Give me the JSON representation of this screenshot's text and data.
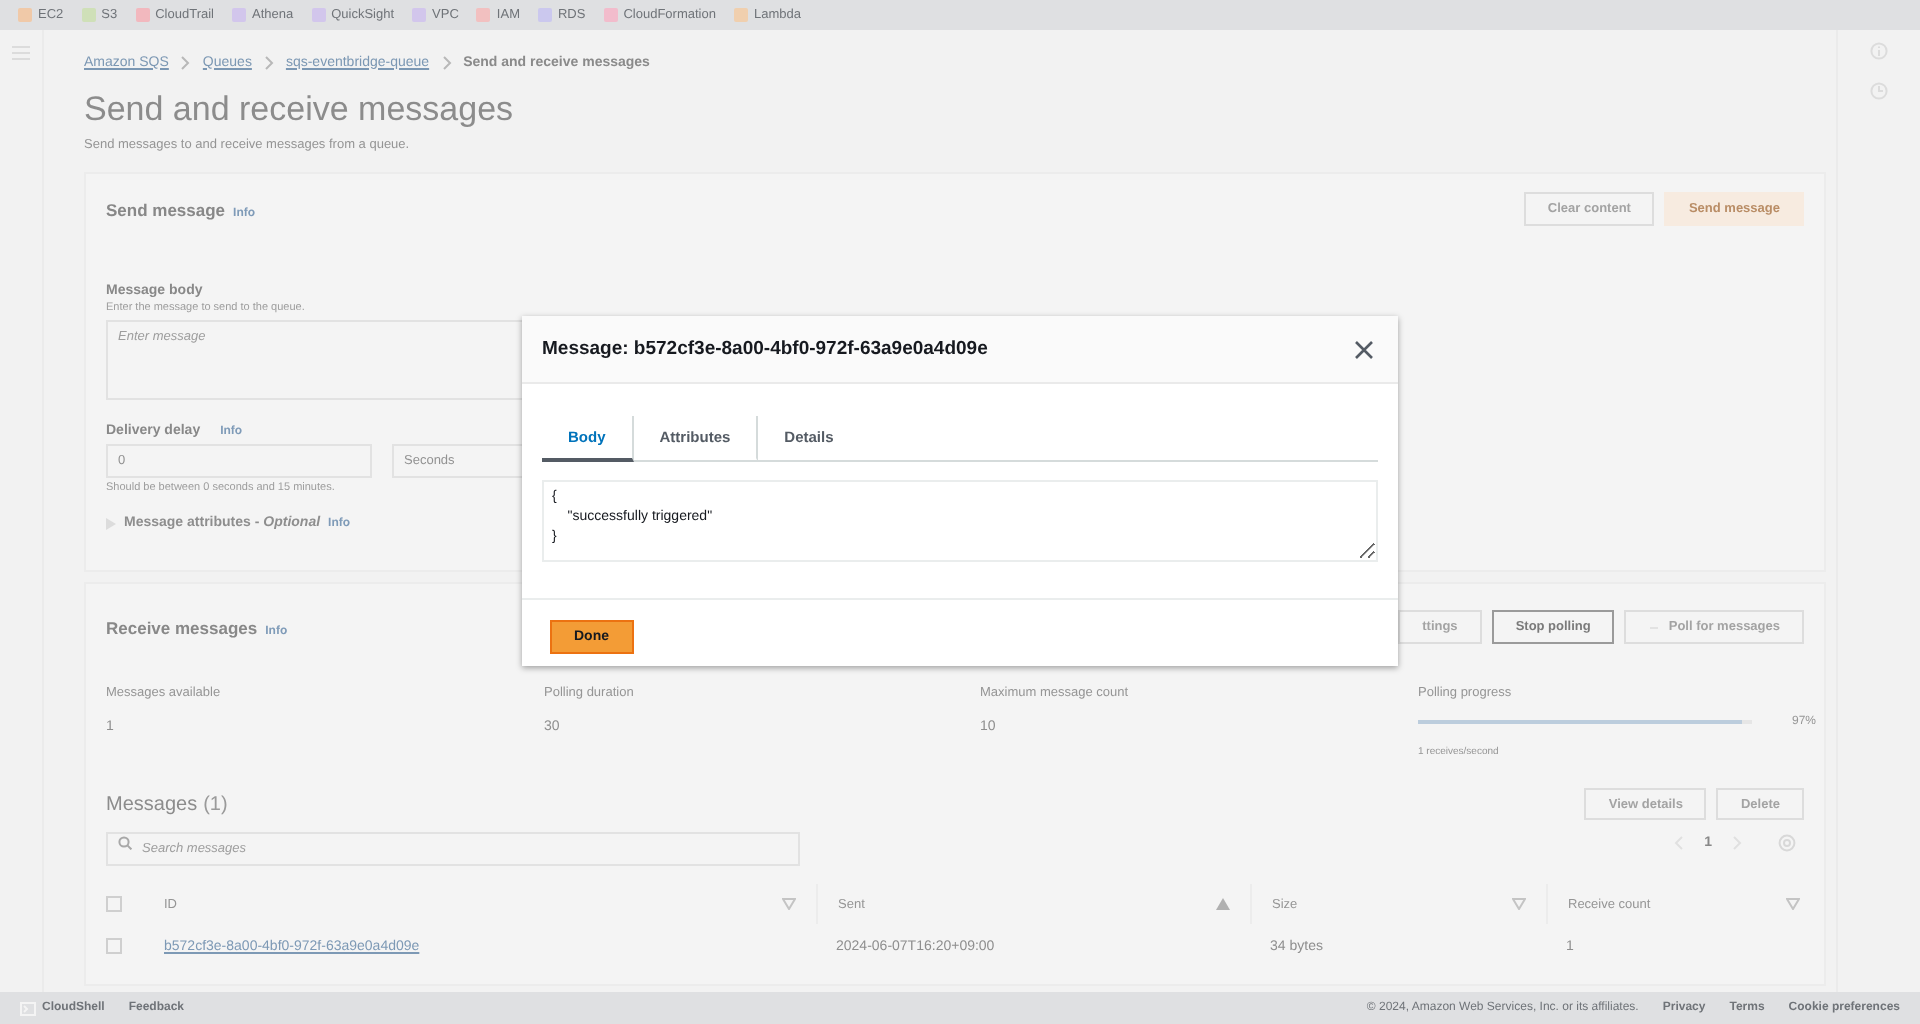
{
  "service_bar": [
    {
      "label": "EC2",
      "color": "#f0c9a8"
    },
    {
      "label": "S3",
      "color": "#cfe0b8"
    },
    {
      "label": "CloudTrail",
      "color": "#f2b8be"
    },
    {
      "label": "Athena",
      "color": "#d2c6ec"
    },
    {
      "label": "QuickSight",
      "color": "#d2c6ec"
    },
    {
      "label": "VPC",
      "color": "#d2c6ec"
    },
    {
      "label": "IAM",
      "color": "#f2c0c0"
    },
    {
      "label": "RDS",
      "color": "#cbc8ee"
    },
    {
      "label": "CloudFormation",
      "color": "#f2bccc"
    },
    {
      "label": "Lambda",
      "color": "#f0cfae"
    }
  ],
  "breadcrumbs": [
    {
      "label": "Amazon SQS",
      "link": true
    },
    {
      "label": "Queues",
      "link": true
    },
    {
      "label": "sqs-eventbridge-queue",
      "link": true
    },
    {
      "label": "Send and receive messages",
      "link": false
    }
  ],
  "page": {
    "title": "Send and receive messages",
    "subtitle": "Send messages to and receive messages from a queue."
  },
  "send_message": {
    "title": "Send message",
    "info": "Info",
    "buttons": [
      {
        "label": "Clear content",
        "primary": false
      },
      {
        "label": "Send message",
        "primary": true
      }
    ],
    "message_body": {
      "label": "Message body",
      "hint": "Enter the message to send to the queue.",
      "placeholder": "Enter message"
    },
    "delivery_delay": {
      "label": "Delivery delay",
      "info": "Info",
      "value": "0",
      "unit": "Seconds",
      "hint": "Should be between 0 seconds and 15 minutes."
    },
    "attributes": {
      "label": "Message attributes - *Optional*",
      "info": "Info",
      "expanded": false
    }
  },
  "receive_messages": {
    "title": "Receive messages",
    "info": "Info",
    "buttons": [
      {
        "label": "ttings",
        "primary": false
      },
      {
        "label": "Stop polling",
        "primary": true
      },
      {
        "label": "Poll for messages",
        "primary": false
      }
    ],
    "stats": [
      {
        "label": "Messages available",
        "value": "1"
      },
      {
        "label": "Polling duration",
        "value": "30"
      },
      {
        "label": "Maximum message count",
        "value": "10"
      }
    ],
    "polling_progress": {
      "label": "Polling progress",
      "level": 0.97,
      "reading": "97%",
      "note": "1 receives/second"
    }
  },
  "messages": {
    "title": "Messages",
    "count": "(1)",
    "buttons": [
      "View details",
      "Delete"
    ],
    "page": "1",
    "search": {
      "placeholder": "Search messages"
    },
    "select_all_checked": false,
    "columns": [
      {
        "label": "ID"
      },
      {
        "label": "Sent"
      },
      {
        "label": "Size"
      },
      {
        "label": "Receive count"
      }
    ],
    "rows": [
      {
        "checked": false,
        "cells": [
          "b572cf3e-8a00-4bf0-972f-63a9e0a4d09e",
          "2024-06-07T16:20+09:00",
          "34 bytes",
          "1"
        ]
      }
    ]
  },
  "footer": {
    "left": [
      "CloudShell",
      "Feedback"
    ],
    "copyright": "© 2024, Amazon Web Services, Inc. or its affiliates.",
    "links": [
      "Privacy",
      "Terms",
      "Cookie preferences"
    ]
  },
  "modal": {
    "title": "Message: b572cf3e-8a00-4bf0-972f-63a9e0a4d09e",
    "tabs": [
      {
        "label": "Body",
        "selected": true
      },
      {
        "label": "Attributes",
        "selected": false
      },
      {
        "label": "Details",
        "selected": false
      }
    ],
    "body": "{\n    \"successfully triggered\"\n}",
    "done": "Done"
  }
}
